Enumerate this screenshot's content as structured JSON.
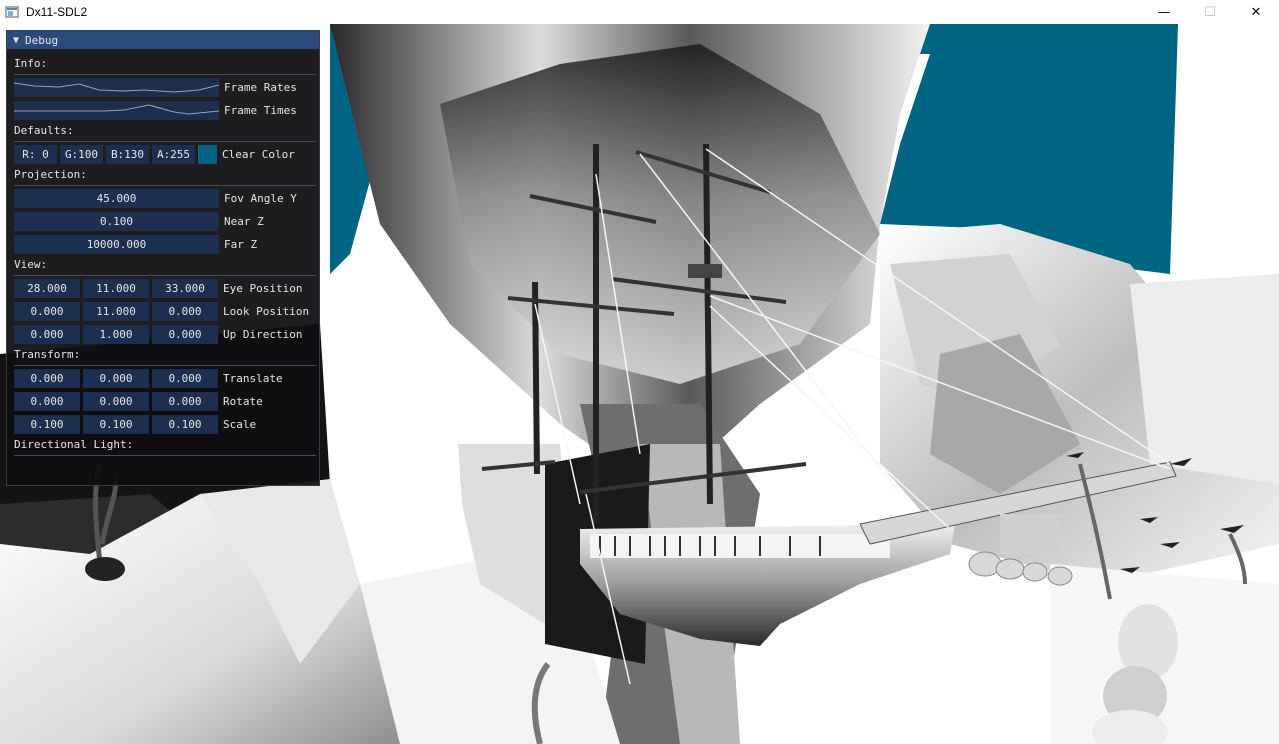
{
  "window": {
    "title": "Dx11-SDL2",
    "controls": {
      "minimize": "—",
      "maximize": "☐",
      "close": "✕"
    }
  },
  "scene": {
    "sky_color": "#006482"
  },
  "debug": {
    "title": "Debug",
    "collapse_icon": "triangle-down-icon",
    "info": {
      "header": "Info:",
      "frame_rates_label": "Frame Rates",
      "frame_times_label": "Frame Times"
    },
    "defaults": {
      "header": "Defaults:",
      "clear_color": {
        "r": "R:  0",
        "g": "G:100",
        "b": "B:130",
        "a": "A:255",
        "label": "Clear Color",
        "swatch": "#006482"
      }
    },
    "projection": {
      "header": "Projection:",
      "fov": {
        "value": "45.000",
        "label": "Fov Angle Y"
      },
      "near": {
        "value": "0.100",
        "label": "Near Z"
      },
      "far": {
        "value": "10000.000",
        "label": "Far Z"
      }
    },
    "view": {
      "header": "View:",
      "eye": {
        "x": "28.000",
        "y": "11.000",
        "z": "33.000",
        "label": "Eye Position"
      },
      "look": {
        "x": "0.000",
        "y": "11.000",
        "z": "0.000",
        "label": "Look Position"
      },
      "up": {
        "x": "0.000",
        "y": "1.000",
        "z": "0.000",
        "label": "Up Direction"
      }
    },
    "transform": {
      "header": "Transform:",
      "translate": {
        "x": "0.000",
        "y": "0.000",
        "z": "0.000",
        "label": "Translate"
      },
      "rotate": {
        "x": "0.000",
        "y": "0.000",
        "z": "0.000",
        "label": "Rotate"
      },
      "scale": {
        "x": "0.100",
        "y": "0.100",
        "z": "0.100",
        "label": "Scale"
      }
    },
    "directional_light": {
      "header": "Directional Light:"
    }
  }
}
